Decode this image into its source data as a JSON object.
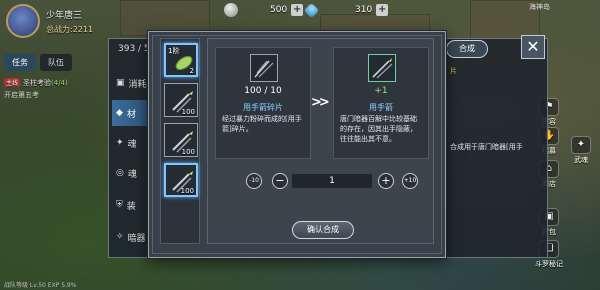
{
  "player": {
    "name": "少年唐三",
    "power": "总战力:2211"
  },
  "left_tabs": [
    {
      "label": "任务"
    },
    {
      "label": "队伍"
    }
  ],
  "quest": {
    "tag": "主线",
    "title": "圣柱考验",
    "progress": "(4/4)",
    "next": "开启第五考"
  },
  "currency": {
    "coins": "500",
    "gems": "310"
  },
  "map_label": "海神岛",
  "right_menu": [
    {
      "label": "阵容",
      "icon": "formation-icon"
    },
    {
      "label": "招募",
      "icon": "recruit-icon"
    },
    {
      "label": "武魂",
      "icon": "soul-icon"
    },
    {
      "label": "商店",
      "icon": "shop-icon"
    },
    {
      "label": "背包",
      "icon": "bag-icon"
    },
    {
      "label": "斗罗秘记",
      "icon": "book-icon"
    }
  ],
  "back_panel": {
    "header": "393 / 5",
    "tabs": [
      {
        "label": "消耗",
        "icon": "bag-icon"
      },
      {
        "label": "材",
        "icon": "material-icon"
      },
      {
        "label": "魂",
        "icon": "soul-icon"
      },
      {
        "label": "魂",
        "icon": "ring-icon"
      },
      {
        "label": "装",
        "icon": "shield-icon"
      },
      {
        "label": "暗器",
        "icon": "star-icon"
      }
    ],
    "right_button": "合成",
    "right_note_top": "片",
    "right_note_bottom": "合成用于唐门暗器[用手"
  },
  "dialog": {
    "list": [
      {
        "level": "1阶",
        "qty": "2",
        "icon": "leaf-icon"
      },
      {
        "level": "",
        "qty": "100",
        "icon": "dart-icon"
      },
      {
        "level": "",
        "qty": "100",
        "icon": "dart-icon"
      },
      {
        "level": "",
        "qty": "100",
        "icon": "dart-icon"
      }
    ],
    "source": {
      "count": "100 / 10",
      "name": "用手箭碎片",
      "desc": "经过暴力粉碎而成的[用手箭]碎片。"
    },
    "arrow": ">>",
    "target": {
      "count": "+1",
      "name": "用手箭",
      "desc": "唐门暗器百解中比较基础的存在，因其出手隐蔽，往往能出其不意。"
    },
    "stepper": {
      "minus10": "-10",
      "minus": "−",
      "value": "1",
      "plus": "+",
      "plus10": "+10"
    },
    "confirm": "确认合成"
  },
  "bottom_bar": "战队等级 Lv.50   EXP 5.9%"
}
